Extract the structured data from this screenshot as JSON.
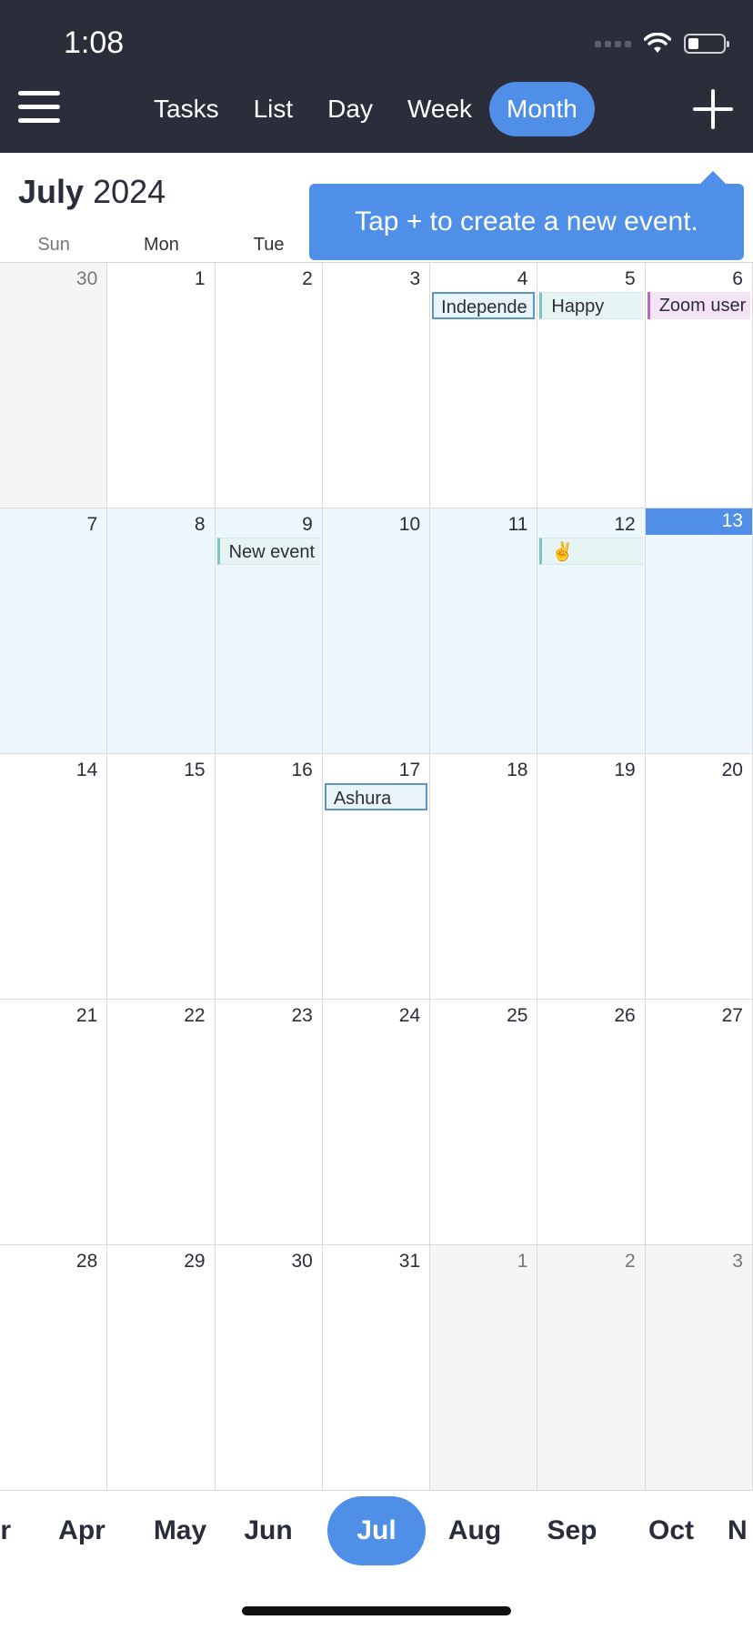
{
  "status_bar": {
    "time": "1:08"
  },
  "toolbar": {
    "tabs": [
      "Tasks",
      "List",
      "Day",
      "Week",
      "Month"
    ],
    "active_tab": "Month"
  },
  "header": {
    "month": "July",
    "year": "2024"
  },
  "tooltip": {
    "text": "Tap + to create a new event."
  },
  "weekdays": [
    "Sun",
    "Mon",
    "Tue"
  ],
  "weeks": [
    [
      {
        "day": "30",
        "other": true
      },
      {
        "day": "1"
      },
      {
        "day": "2"
      },
      {
        "day": "3"
      },
      {
        "day": "4",
        "event": "Independe",
        "style": "outline"
      },
      {
        "day": "5",
        "event": "Happy",
        "style": "teal"
      },
      {
        "day": "6",
        "event": "Zoom user",
        "style": "purple"
      }
    ],
    [
      {
        "day": "7"
      },
      {
        "day": "8"
      },
      {
        "day": "9",
        "event": "New event",
        "style": "teal"
      },
      {
        "day": "10"
      },
      {
        "day": "11"
      },
      {
        "day": "12",
        "event": "✌️",
        "style": "teal"
      },
      {
        "day": "13",
        "today": true
      }
    ],
    [
      {
        "day": "14"
      },
      {
        "day": "15"
      },
      {
        "day": "16"
      },
      {
        "day": "17",
        "event": "Ashura",
        "style": "outline"
      },
      {
        "day": "18"
      },
      {
        "day": "19"
      },
      {
        "day": "20"
      }
    ],
    [
      {
        "day": "21"
      },
      {
        "day": "22"
      },
      {
        "day": "23"
      },
      {
        "day": "24"
      },
      {
        "day": "25"
      },
      {
        "day": "26"
      },
      {
        "day": "27"
      }
    ],
    [
      {
        "day": "28"
      },
      {
        "day": "29"
      },
      {
        "day": "30"
      },
      {
        "day": "31"
      },
      {
        "day": "1",
        "other": true
      },
      {
        "day": "2",
        "other": true
      },
      {
        "day": "3",
        "other": true
      }
    ]
  ],
  "current_week_index": 1,
  "month_strip": {
    "items": [
      "r",
      "Apr",
      "May",
      "Jun",
      "Jul",
      "Aug",
      "Sep",
      "Oct",
      "N"
    ],
    "active": "Jul"
  },
  "colors": {
    "accent": "#4f8fe8",
    "topbar": "#2a2d3a"
  }
}
